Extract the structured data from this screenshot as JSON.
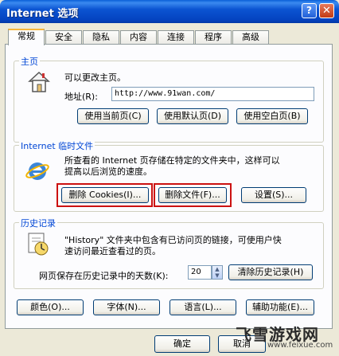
{
  "window": {
    "title": "Internet 选项",
    "help_button": "?",
    "close_button": "✕"
  },
  "tabs": [
    {
      "label": "常规",
      "active": true
    },
    {
      "label": "安全"
    },
    {
      "label": "隐私"
    },
    {
      "label": "内容"
    },
    {
      "label": "连接"
    },
    {
      "label": "程序"
    },
    {
      "label": "高级"
    }
  ],
  "homepage": {
    "legend": "主页",
    "description": "可以更改主页。",
    "address_label": "地址(R):",
    "address_value": "http://www.91wan.com/",
    "buttons": [
      "使用当前页(C)",
      "使用默认页(D)",
      "使用空白页(B)"
    ]
  },
  "temp_files": {
    "legend": "Internet 临时文件",
    "description_line1": "所查看的 Internet 页存储在特定的文件夹中，这样可以",
    "description_line2": "提高以后浏览的速度。",
    "buttons": [
      "删除 Cookies(I)...",
      "删除文件(F)...",
      "设置(S)..."
    ]
  },
  "history": {
    "legend": "历史记录",
    "description_line1": "\"History\" 文件夹中包含有已访问页的链接，可使用户快",
    "description_line2": "速访问最近查看过的页。",
    "days_label": "网页保存在历史记录中的天数(K):",
    "days_value": "20",
    "clear_button": "清除历史记录(H)"
  },
  "bottom_buttons": [
    "颜色(O)...",
    "字体(N)...",
    "语言(L)...",
    "辅助功能(E)..."
  ],
  "dialog_buttons": {
    "ok": "确定",
    "cancel": "取消"
  },
  "watermark": {
    "main": "飞雪游戏网",
    "sub": "www.feixue.com"
  },
  "colors": {
    "titlebar": "#0443c0",
    "accent_tab": "#f6b53a",
    "highlight": "#cc1111",
    "legend_text": "#0046d5"
  }
}
